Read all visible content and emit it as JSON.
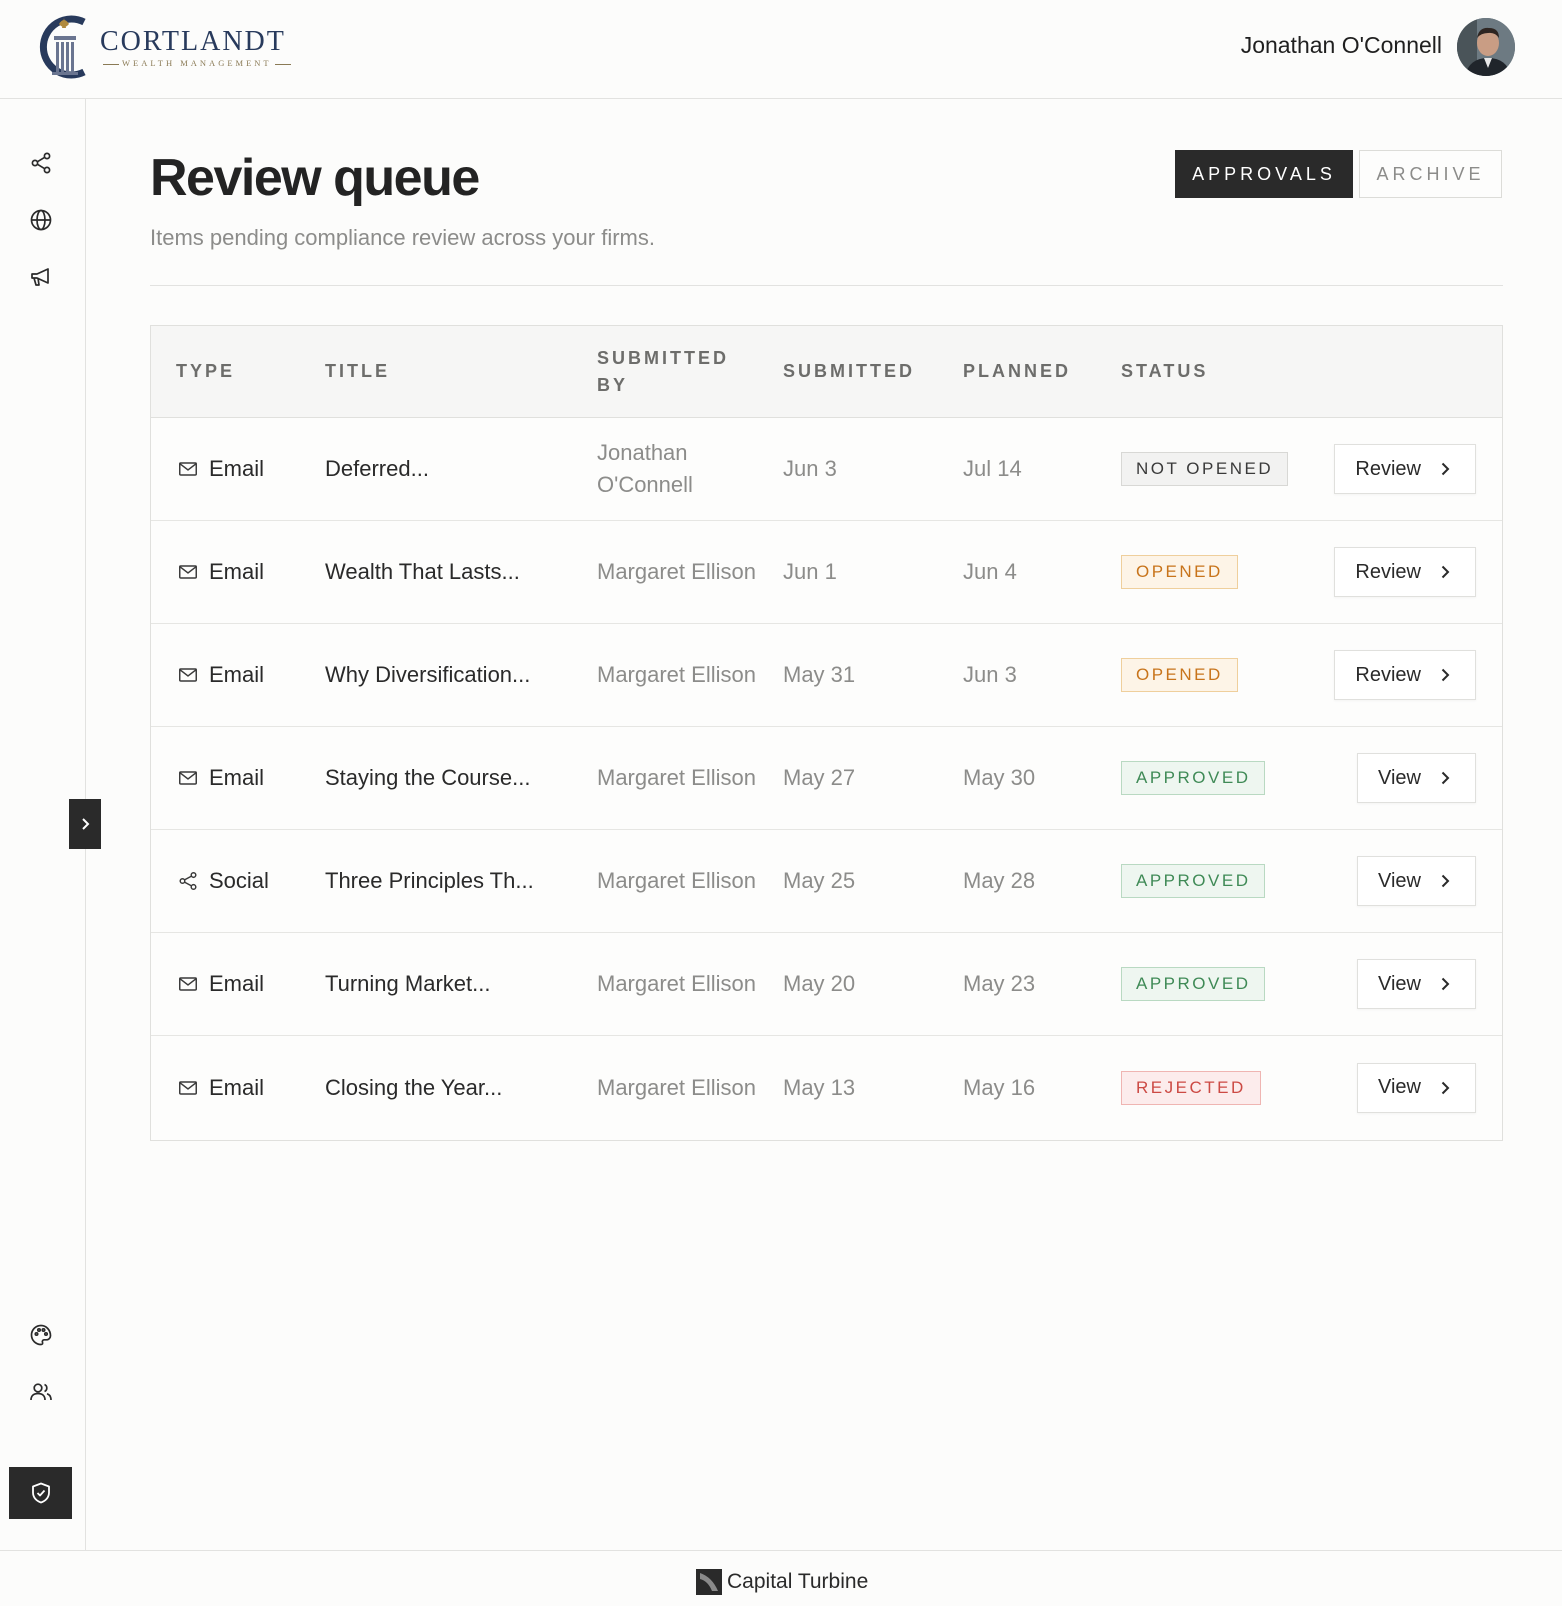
{
  "brand": {
    "name": "CORTLANDT",
    "tagline": "WEALTH MANAGEMENT",
    "logo_icon": "pillar-c-logo"
  },
  "user": {
    "name": "Jonathan O'Connell",
    "avatar_icon": "user-avatar"
  },
  "sidebar": {
    "top_items": [
      {
        "icon": "share-icon"
      },
      {
        "icon": "globe-icon"
      },
      {
        "icon": "megaphone-icon"
      }
    ],
    "bottom_items": [
      {
        "icon": "palette-icon"
      },
      {
        "icon": "users-icon"
      },
      {
        "icon": "shield-check-icon",
        "active": true
      }
    ],
    "collapse_icon": "chevron-right-icon"
  },
  "page": {
    "title": "Review queue",
    "subtitle": "Items pending compliance review across your firms."
  },
  "tabs": [
    {
      "label": "APPROVALS",
      "active": true
    },
    {
      "label": "ARCHIVE",
      "active": false
    }
  ],
  "table": {
    "headers": {
      "type": "TYPE",
      "title": "TITLE",
      "submitted_by_1": "SUBMITTED",
      "submitted_by_2": "BY",
      "submitted": "SUBMITTED",
      "planned": "PLANNED",
      "status": "STATUS"
    },
    "rows": [
      {
        "type": "Email",
        "type_icon": "mail-icon",
        "title": "Deferred...",
        "by": "Jonathan O'Connell",
        "submitted": "Jun 3",
        "planned": "Jul 14",
        "status": "NOT OPENED",
        "action": "Review"
      },
      {
        "type": "Email",
        "type_icon": "mail-icon",
        "title": "Wealth That Lasts...",
        "by": "Margaret Ellison",
        "submitted": "Jun 1",
        "planned": "Jun 4",
        "status": "OPENED",
        "action": "Review"
      },
      {
        "type": "Email",
        "type_icon": "mail-icon",
        "title": "Why Diversification...",
        "by": "Margaret Ellison",
        "submitted": "May 31",
        "planned": "Jun 3",
        "status": "OPENED",
        "action": "Review"
      },
      {
        "type": "Email",
        "type_icon": "mail-icon",
        "title": "Staying the Course...",
        "by": "Margaret Ellison",
        "submitted": "May 27",
        "planned": "May 30",
        "status": "APPROVED",
        "action": "View"
      },
      {
        "type": "Social",
        "type_icon": "share-icon",
        "title": "Three Principles Th...",
        "by": "Margaret Ellison",
        "submitted": "May 25",
        "planned": "May 28",
        "status": "APPROVED",
        "action": "View"
      },
      {
        "type": "Email",
        "type_icon": "mail-icon",
        "title": "Turning Market...",
        "by": "Margaret Ellison",
        "submitted": "May 20",
        "planned": "May 23",
        "status": "APPROVED",
        "action": "View"
      },
      {
        "type": "Email",
        "type_icon": "mail-icon",
        "title": "Closing the Year...",
        "by": "Margaret Ellison",
        "submitted": "May 13",
        "planned": "May 16",
        "status": "REJECTED",
        "action": "View"
      }
    ]
  },
  "status_colors": {
    "NOT OPENED": {
      "text": "#3a3a3a",
      "bg": "#f2f2f1",
      "border": "#d8d8d5"
    },
    "OPENED": {
      "text": "#c8741b",
      "bg": "#fdf4e7",
      "border": "#efcf9c"
    },
    "APPROVED": {
      "text": "#3f8a56",
      "bg": "#eef6f0",
      "border": "#b9d9c2"
    },
    "REJECTED": {
      "text": "#cc4a44",
      "bg": "#fcecec",
      "border": "#efb5b2"
    }
  },
  "footer": {
    "brand": "Capital Turbine",
    "icon": "capital-turbine-logo"
  }
}
